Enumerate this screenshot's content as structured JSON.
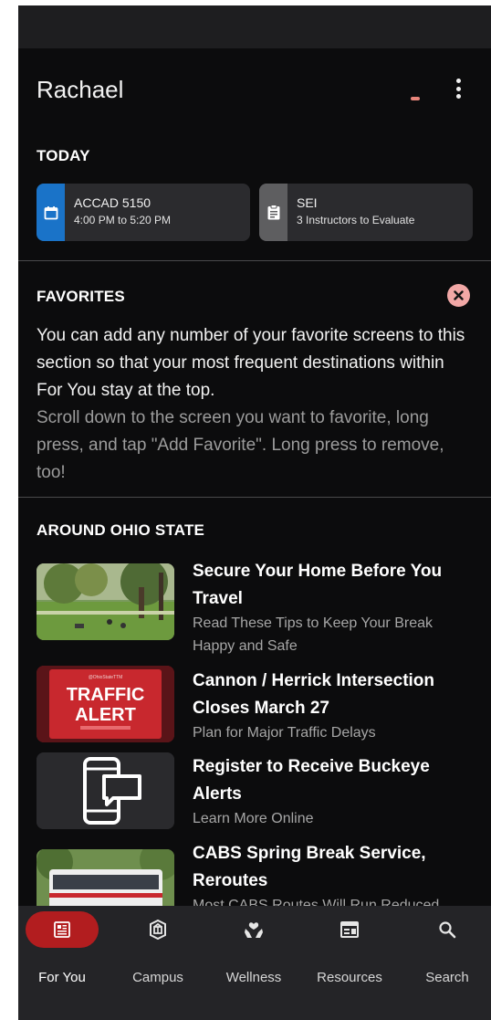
{
  "user": {
    "name": "Rachael"
  },
  "today": {
    "heading": "TODAY",
    "cards": [
      {
        "title": "ACCAD 5150",
        "subtitle": "4:00 PM to 5:20 PM",
        "icon": "calendar-icon",
        "accent": "#1a73c8"
      },
      {
        "title": "SEI",
        "subtitle": "3 Instructors to Evaluate",
        "icon": "clipboard-icon",
        "accent": "#5e5e60"
      }
    ]
  },
  "favorites": {
    "heading": "FAVORITES",
    "text_primary": "You can add any number of your favorite screens to this section so that your most frequent destinations within For You stay at the top.",
    "text_secondary": "Scroll down to the screen you want to favorite, long press, and tap \"Add Favorite\". Long press to remove, too!",
    "close_icon": "close-circle-icon",
    "close_color": "#f2a8a6"
  },
  "around": {
    "heading": "AROUND OHIO STATE",
    "items": [
      {
        "title": "Secure Your Home Before You Travel",
        "subtitle": "Read These Tips to Keep Your Break Happy and Safe",
        "thumb": "campus-lawn-photo"
      },
      {
        "title": "Cannon / Herrick Intersection Closes March 27",
        "subtitle": "Plan for Major Traffic Delays",
        "thumb": "traffic-alert-sign",
        "thumb_line1": "TRAFFIC",
        "thumb_line2": "ALERT",
        "thumb_caption": "@OhioStateTTM"
      },
      {
        "title": "Register to Receive Buckeye Alerts",
        "subtitle": "Learn More Online",
        "thumb": "phone-message-icon"
      },
      {
        "title": "CABS Spring Break Service, Reroutes",
        "subtitle": "Most CABS Routes Will Run Reduced",
        "thumb": "bus-photo"
      }
    ]
  },
  "tabs": [
    {
      "label": "For You",
      "icon": "newspaper-icon",
      "active": true
    },
    {
      "label": "Campus",
      "icon": "campus-icon",
      "active": false
    },
    {
      "label": "Wellness",
      "icon": "wellness-hands-icon",
      "active": false
    },
    {
      "label": "Resources",
      "icon": "resources-icon",
      "active": false
    },
    {
      "label": "Search",
      "icon": "search-icon",
      "active": false
    }
  ],
  "colors": {
    "brand_red": "#b21d1f",
    "background": "#0c0c0d",
    "card": "#2b2b2e",
    "tabbar": "#242427"
  }
}
